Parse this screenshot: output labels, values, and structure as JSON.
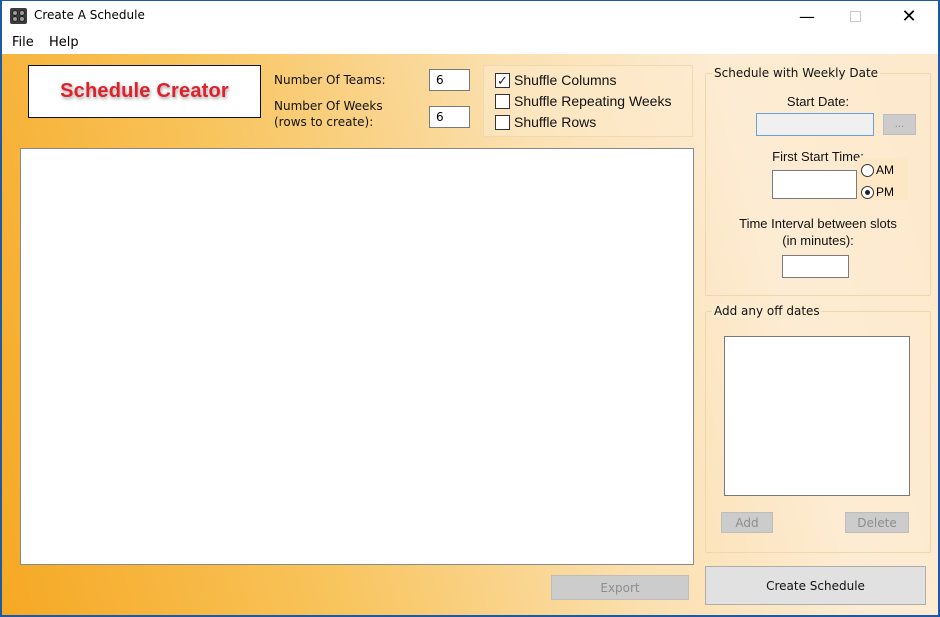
{
  "window": {
    "title": "Create A Schedule",
    "controls": {
      "minimize": "—",
      "maximize": "□",
      "close": "✕"
    }
  },
  "menu": {
    "items": [
      "File",
      "Help"
    ]
  },
  "logo": {
    "text": "Schedule Creator",
    "color": "#e0202a"
  },
  "settings": {
    "teams_label": "Number Of Teams:",
    "teams_value": "6",
    "weeks_label_line1": "Number Of Weeks",
    "weeks_label_line2": "(rows to create):",
    "weeks_value": "6"
  },
  "options": [
    {
      "label": "Shuffle Columns",
      "checked": true,
      "mark": "✓"
    },
    {
      "label": "Shuffle Repeating Weeks",
      "checked": false,
      "mark": ""
    },
    {
      "label": "Shuffle Rows",
      "checked": false,
      "mark": ""
    }
  ],
  "weekly": {
    "legend": "Schedule with Weekly Date",
    "start_date_label": "Start Date:",
    "start_date_value": "",
    "browse_label": "...",
    "first_start_label": "First Start Time:",
    "first_start_value": "",
    "am_label": "AM",
    "pm_label": "PM",
    "selected_period": "PM",
    "interval_label_line1": "Time Interval between slots",
    "interval_label_line2": "(in minutes):",
    "interval_value": ""
  },
  "off_dates": {
    "legend": "Add any off dates",
    "items": [],
    "add_label": "Add",
    "delete_label": "Delete"
  },
  "actions": {
    "export_label": "Export",
    "create_label": "Create Schedule"
  }
}
